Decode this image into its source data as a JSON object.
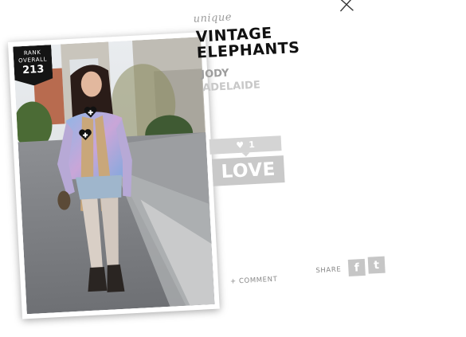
{
  "rank": {
    "label_line1": "RANK",
    "label_line2": "OVERALL",
    "value": "213"
  },
  "look": {
    "category": "unique",
    "title": "VINTAGE ELEPHANTS",
    "author": "JODY",
    "location": "ADELAIDE"
  },
  "love": {
    "count": "1",
    "button_label": "LOVE"
  },
  "actions": {
    "comment_label": "+ COMMENT",
    "share_label": "SHARE",
    "facebook_glyph": "f",
    "twitter_glyph": "t"
  },
  "icons": {
    "close": "close-icon",
    "heart": "heart-icon",
    "add_hotspot": "heart-plus-icon",
    "facebook": "facebook-icon",
    "twitter": "twitter-icon"
  },
  "colors": {
    "badge": "#141414",
    "love_gray": "#c9c9c9",
    "title": "#111111",
    "subtle": "#9d9d9d"
  }
}
